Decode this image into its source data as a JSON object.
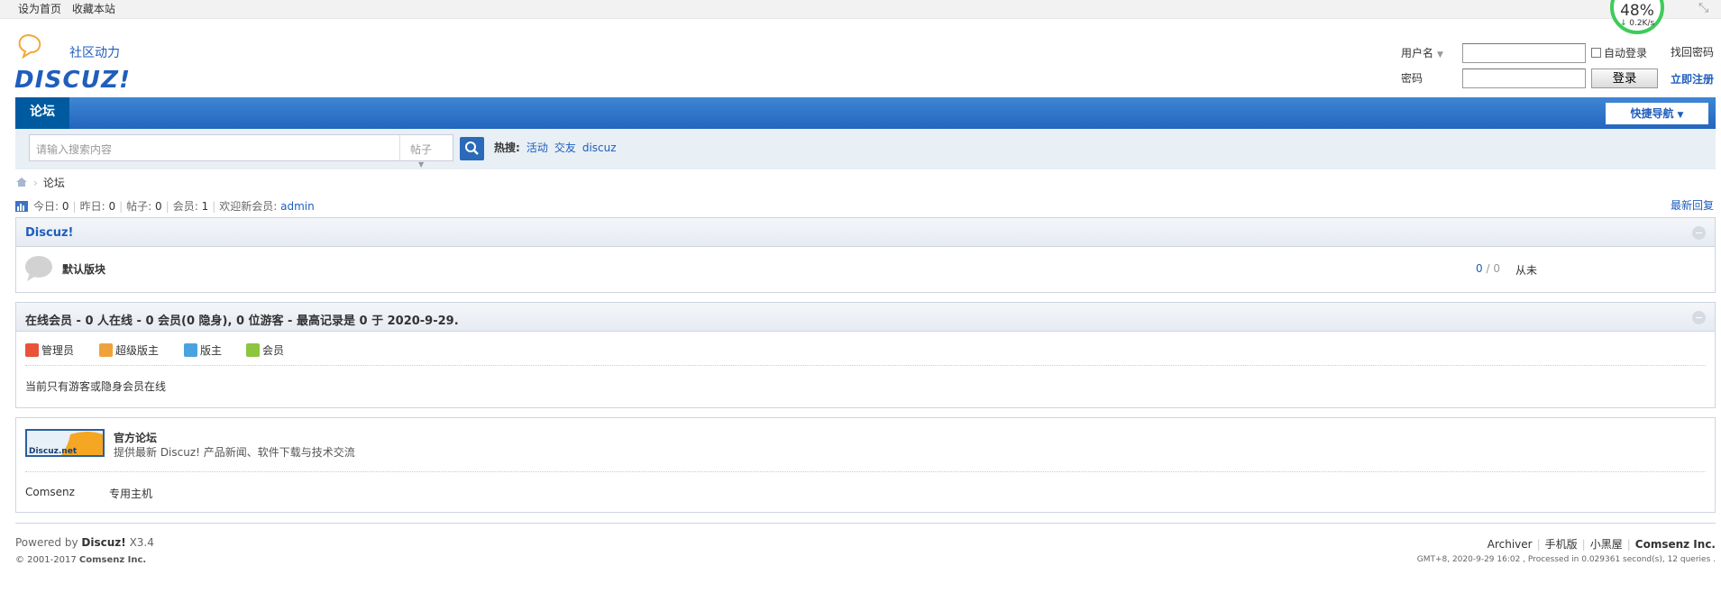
{
  "topbar": {
    "set_home": "设为首页",
    "bookmark": "收藏本站"
  },
  "netmonitor": {
    "percent": "48%",
    "speed": "0.2K/s"
  },
  "logo": {
    "tagline": "社区动力",
    "text": "DISCUZ!"
  },
  "login": {
    "username_label": "用户名",
    "password_label": "密码",
    "auto_login": "自动登录",
    "login_button": "登录",
    "find_password": "找回密码",
    "register": "立即注册",
    "username_value": "",
    "password_value": ""
  },
  "nav": {
    "forum_tab": "论坛",
    "quick_nav": "快捷导航"
  },
  "search": {
    "placeholder": "请输入搜索内容",
    "type": "帖子",
    "hot_label": "热搜:",
    "hot_items": [
      "活动",
      "交友",
      "discuz"
    ]
  },
  "breadcrumb": {
    "current": "论坛"
  },
  "stats": {
    "today_label": "今日:",
    "today": "0",
    "yesterday_label": "昨日:",
    "yesterday": "0",
    "posts_label": "帖子:",
    "posts": "0",
    "members_label": "会员:",
    "members": "1",
    "welcome_label": "欢迎新会员:",
    "newest": "admin",
    "latest_replies": "最新回复"
  },
  "category": {
    "title": "Discuz!",
    "forum_name": "默认版块",
    "threads": "0",
    "sep": "/",
    "posts": "0",
    "last_post": "从未"
  },
  "online": {
    "title": "在线会员 - 0 人在线 - 0 会员(0 隐身), 0 位游客 - 最高记录是 0 于 2020-9-29.",
    "legend": [
      "管理员",
      "超级版主",
      "版主",
      "会员"
    ],
    "legend_colors": [
      "#e8533a",
      "#f0a23a",
      "#4aa3df",
      "#8cc63e"
    ],
    "text": "当前只有游客或隐身会员在线"
  },
  "friendlinks": {
    "logo_text": "Discuz.net",
    "title": "官方论坛",
    "desc": "提供最新 Discuz! 产品新闻、软件下载与技术交流",
    "text_links": [
      "Comsenz",
      "专用主机"
    ]
  },
  "footer": {
    "powered_prefix": "Powered by",
    "powered_name": "Discuz!",
    "version": "X3.4",
    "copyright": "© 2001-2017",
    "company": "Comsenz Inc.",
    "links": [
      "Archiver",
      "手机版",
      "小黑屋",
      "Comsenz Inc."
    ],
    "info": "GMT+8, 2020-9-29 16:02 , Processed in 0.029361 second(s), 12 queries ."
  }
}
